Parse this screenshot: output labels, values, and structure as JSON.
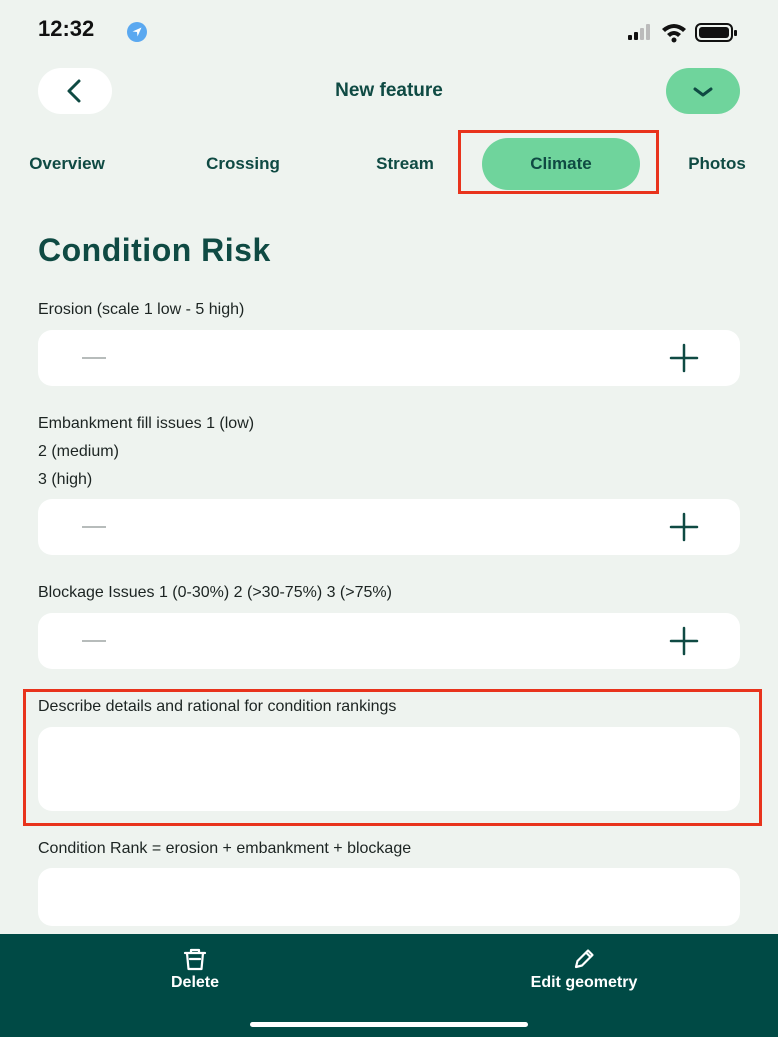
{
  "status": {
    "time": "12:32"
  },
  "header": {
    "title": "New feature"
  },
  "tabs": [
    {
      "label": "Overview",
      "active": false
    },
    {
      "label": "Crossing",
      "active": false
    },
    {
      "label": "Stream",
      "active": false
    },
    {
      "label": "Climate",
      "active": true
    },
    {
      "label": "Photos",
      "active": false
    }
  ],
  "section": {
    "title": "Condition Risk"
  },
  "fields": {
    "erosion": {
      "label": "Erosion (scale 1 low - 5 high)"
    },
    "embankment": {
      "label_lines": [
        "Embankment fill issues 1 (low)",
        "2 (medium)",
        "3 (high)"
      ]
    },
    "blockage": {
      "label": "Blockage Issues 1 (0-30%) 2 (>30-75%) 3 (>75%)"
    },
    "details": {
      "label": "Describe details and rational for condition rankings",
      "value": ""
    },
    "condition_rank": {
      "label": "Condition Rank = erosion + embankment + blockage",
      "value": ""
    }
  },
  "bottom_bar": {
    "delete_label": "Delete",
    "edit_label": "Edit geometry"
  },
  "colors": {
    "accent": "#6fd49c",
    "primary": "#0f4a43",
    "bar": "#004a45",
    "highlight": "#e8331c",
    "background": "#eef3ef"
  }
}
